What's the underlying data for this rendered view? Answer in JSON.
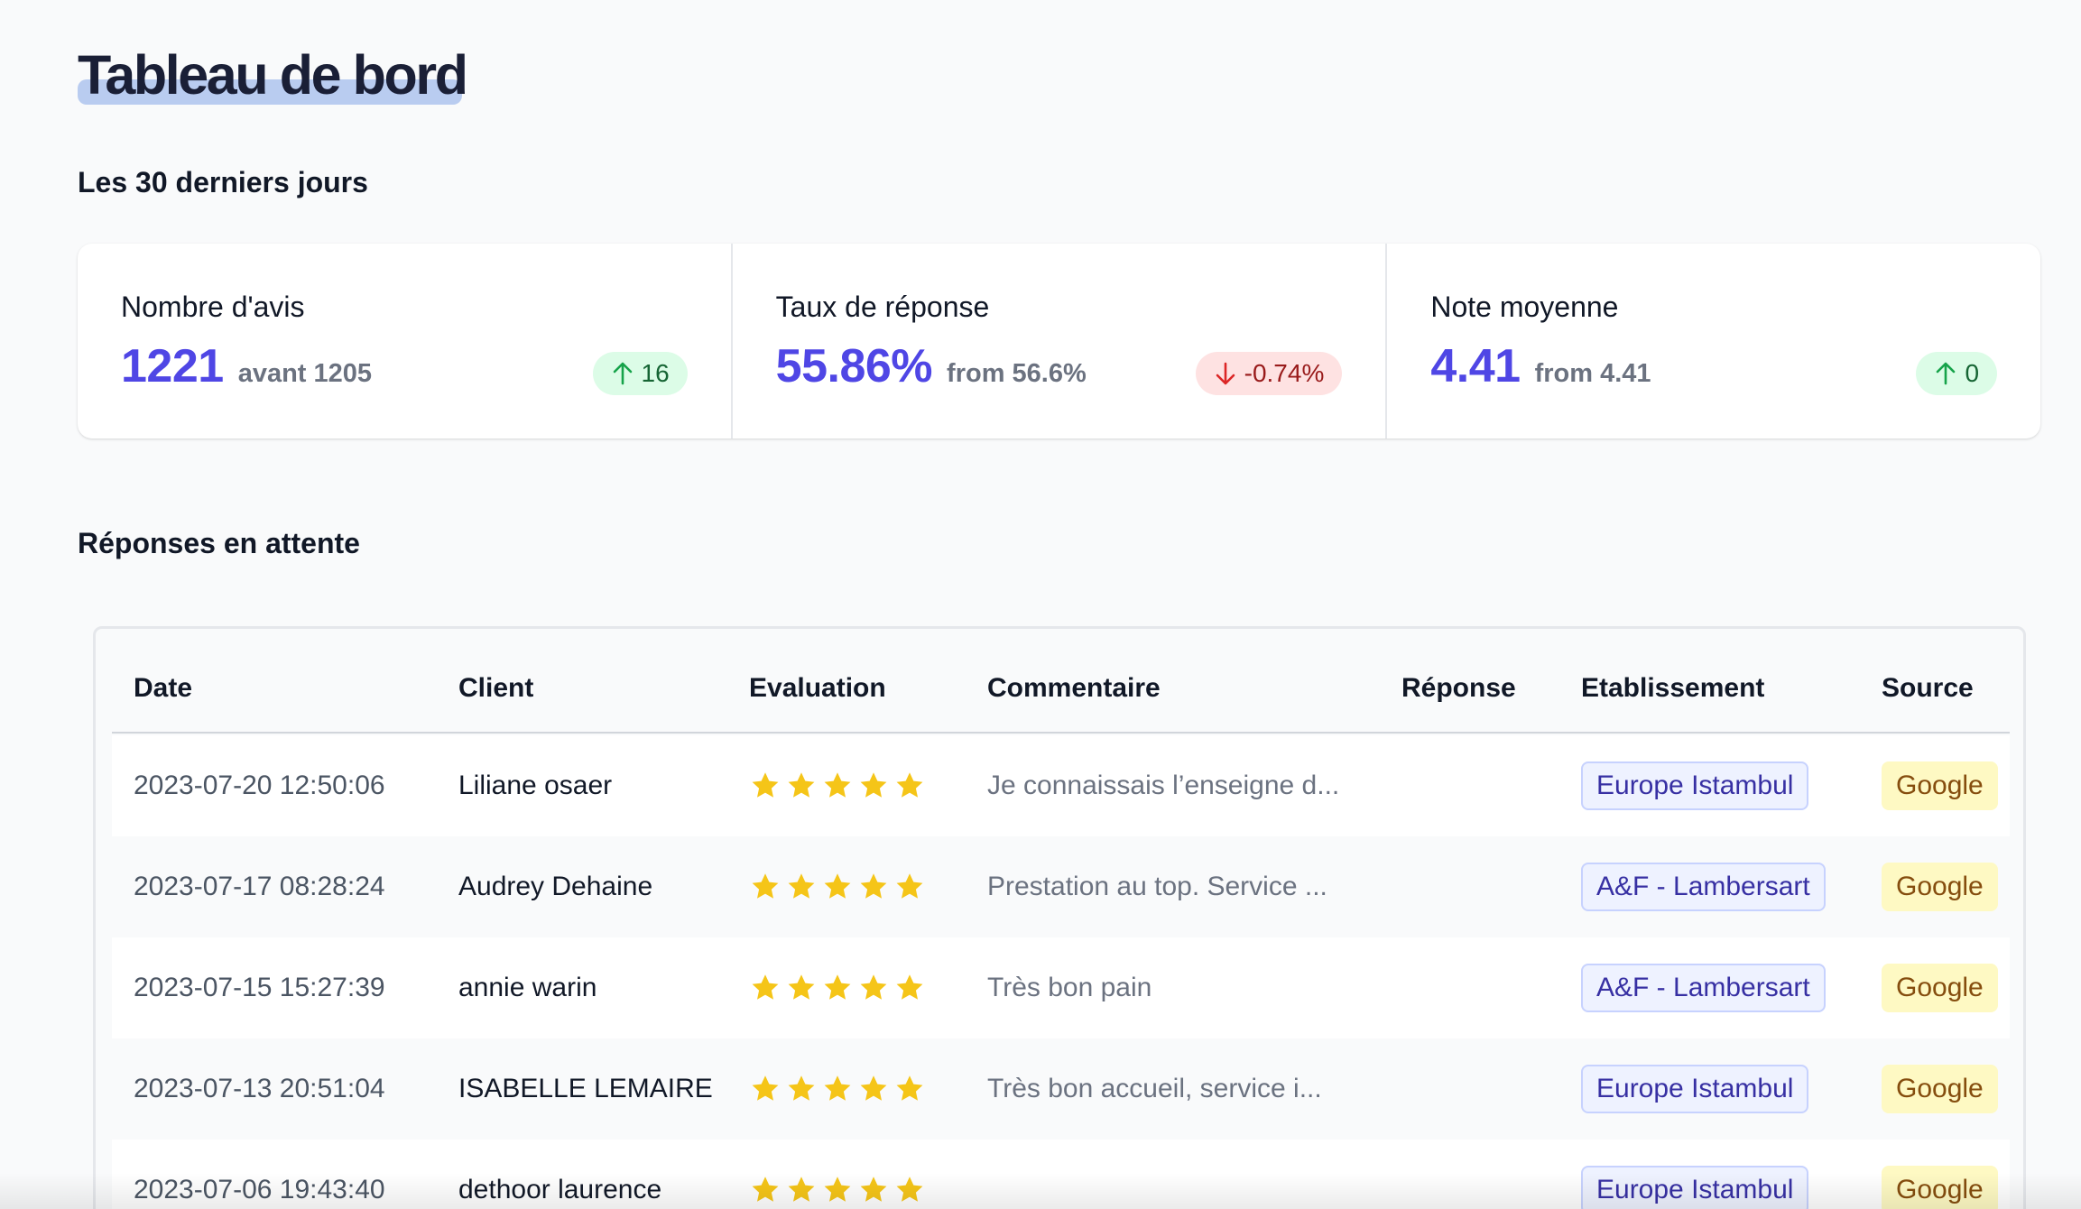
{
  "page": {
    "title": "Tableau de bord",
    "period_label": "Les 30 derniers jours",
    "pending_title": "Réponses en attente"
  },
  "stats": [
    {
      "label": "Nombre d'avis",
      "value": "1221",
      "from": "avant 1205",
      "change": "16",
      "direction": "up"
    },
    {
      "label": "Taux de réponse",
      "value": "55.86%",
      "from": "from 56.6%",
      "change": "-0.74%",
      "direction": "down"
    },
    {
      "label": "Note moyenne",
      "value": "4.41",
      "from": "from 4.41",
      "change": "0",
      "direction": "up"
    }
  ],
  "table": {
    "headers": {
      "date": "Date",
      "client": "Client",
      "evaluation": "Evaluation",
      "commentaire": "Commentaire",
      "reponse": "Réponse",
      "etablissement": "Etablissement",
      "source": "Source"
    },
    "rows": [
      {
        "date": "2023-07-20 12:50:06",
        "client": "Liliane osaer",
        "rating": 5,
        "comment": "Je connaissais l’enseigne d...",
        "reponse": "",
        "etablissement": "Europe Istambul",
        "source": "Google"
      },
      {
        "date": "2023-07-17 08:28:24",
        "client": "Audrey Dehaine",
        "rating": 5,
        "comment": "Prestation au top. Service ...",
        "reponse": "",
        "etablissement": "A&F - Lambersart",
        "source": "Google"
      },
      {
        "date": "2023-07-15 15:27:39",
        "client": "annie warin",
        "rating": 5,
        "comment": "Très bon pain",
        "reponse": "",
        "etablissement": "A&F - Lambersart",
        "source": "Google"
      },
      {
        "date": "2023-07-13 20:51:04",
        "client": "ISABELLE LEMAIRE",
        "rating": 5,
        "comment": "Très bon accueil, service i...",
        "reponse": "",
        "etablissement": "Europe Istambul",
        "source": "Google"
      },
      {
        "date": "2023-07-06 19:43:40",
        "client": "dethoor laurence",
        "rating": 5,
        "comment": "",
        "reponse": "",
        "etablissement": "Europe Istambul",
        "source": "Google"
      }
    ]
  },
  "colors": {
    "accent": "#4f46e5",
    "up_bg": "#dcfce7",
    "up_fg": "#166534",
    "down_bg": "#fee2e2",
    "down_fg": "#991b1b",
    "star": "#f5c518",
    "title_highlight": "#b9ccf0"
  },
  "icons": {
    "up": "arrow-up-icon",
    "down": "arrow-down-icon",
    "rating": "star-icon"
  }
}
